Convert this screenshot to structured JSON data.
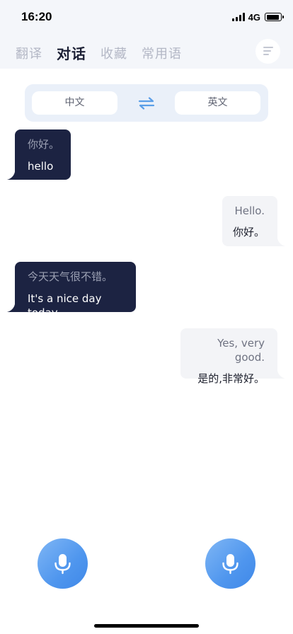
{
  "status_bar": {
    "time": "16:20",
    "network": "4G"
  },
  "tabs": [
    {
      "label": "翻译",
      "active": false
    },
    {
      "label": "对话",
      "active": true
    },
    {
      "label": "收藏",
      "active": false
    },
    {
      "label": "常用语",
      "active": false
    }
  ],
  "menu_icon": "menu-lines-icon",
  "language_bar": {
    "source": "中文",
    "target": "英文",
    "swap_icon": "swap-arrows-icon"
  },
  "messages": [
    {
      "side": "left",
      "original": "你好。",
      "translation": "hello"
    },
    {
      "side": "right",
      "original": "Hello.",
      "translation": "你好。"
    },
    {
      "side": "left",
      "original": "今天天气很不错。",
      "translation": "It's a nice day today."
    },
    {
      "side": "right",
      "original": "Yes, very good.",
      "translation": "是的,非常好。"
    }
  ],
  "mic_buttons": {
    "left_icon": "microphone-icon",
    "right_icon": "microphone-icon"
  },
  "colors": {
    "accent": "#4f96ee",
    "bubble_dark": "#1c2342",
    "bubble_light": "#f3f4f7",
    "header_bg": "#f4f6fa"
  }
}
